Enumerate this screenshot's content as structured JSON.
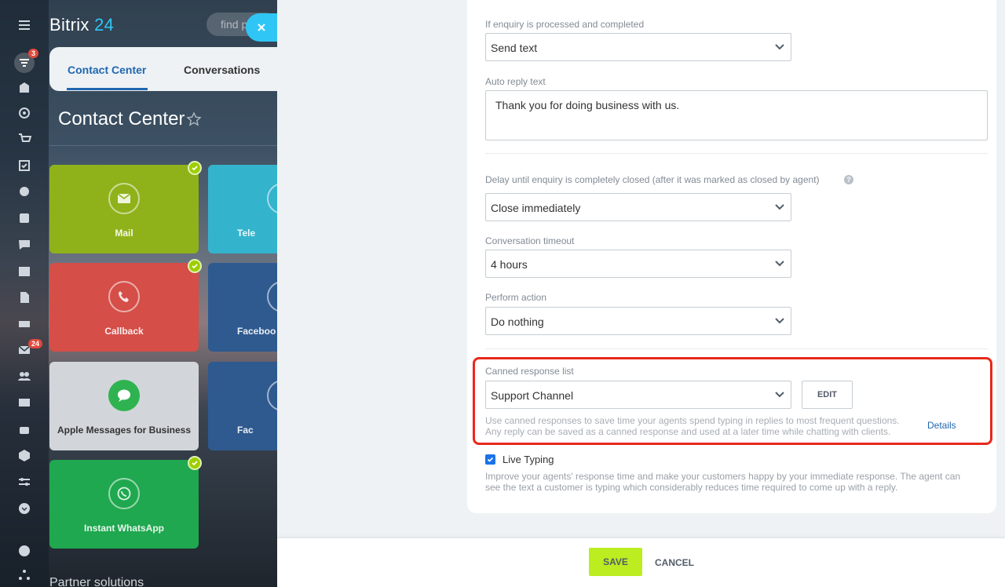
{
  "app": {
    "logo_text": "Bitrix",
    "logo_num": "24",
    "search_placeholder": "find p",
    "rail_badges": {
      "feed": "3",
      "mail": "24"
    }
  },
  "header_tabs": [
    "Contact Center",
    "Conversations"
  ],
  "page_title": "Contact Center",
  "tiles": [
    {
      "label": "Mail",
      "color": "#8fb21a",
      "checked": true
    },
    {
      "label": "Tele",
      "color": "#34b4cc",
      "checked": false
    },
    {
      "label": "Callback",
      "color": "#d54e48",
      "checked": true
    },
    {
      "label": "Faceboo",
      "color": "#2e5a8f",
      "checked": false
    },
    {
      "label": "Apple Messages for Business",
      "color": "#d2d6da",
      "checked": false
    },
    {
      "label": "Fac",
      "color": "#2e5a8f",
      "checked": false
    },
    {
      "label": "Instant WhatsApp",
      "color": "#1fa84f",
      "checked": true
    }
  ],
  "partner_label": "Partner solutions",
  "form": {
    "processed_label": "If enquiry is processed and completed",
    "processed_value": "Send text",
    "autoreply_label": "Auto reply text",
    "autoreply_value": "Thank you for doing business with us.",
    "delay_label": "Delay until enquiry is completely closed (after it was marked as closed by agent)",
    "delay_value": "Close immediately",
    "timeout_label": "Conversation timeout",
    "timeout_value": "4 hours",
    "action_label": "Perform action",
    "action_value": "Do nothing",
    "canned_label": "Canned response list",
    "canned_value": "Support Channel",
    "edit_label": "EDIT",
    "canned_hint_1": "Use canned responses to save time your agents spend typing in replies to most frequent questions.",
    "canned_hint_2": "Any reply can be saved as a canned response and used at a later time while chatting with clients.",
    "details_label": "Details",
    "live_typing_label": "Live Typing",
    "live_typing_checked": true,
    "live_hint_1": "Improve your agents' response time and make your customers happy by your immediate response. The agent can",
    "live_hint_2": "see the text a customer is typing which considerably reduces time required to come up with a reply."
  },
  "footer": {
    "save_label": "SAVE",
    "cancel_label": "CANCEL"
  },
  "colors": {
    "accent": "#2fc6f6",
    "link": "#2067b0",
    "save": "#bbed21",
    "highlight": "#e8291c"
  }
}
